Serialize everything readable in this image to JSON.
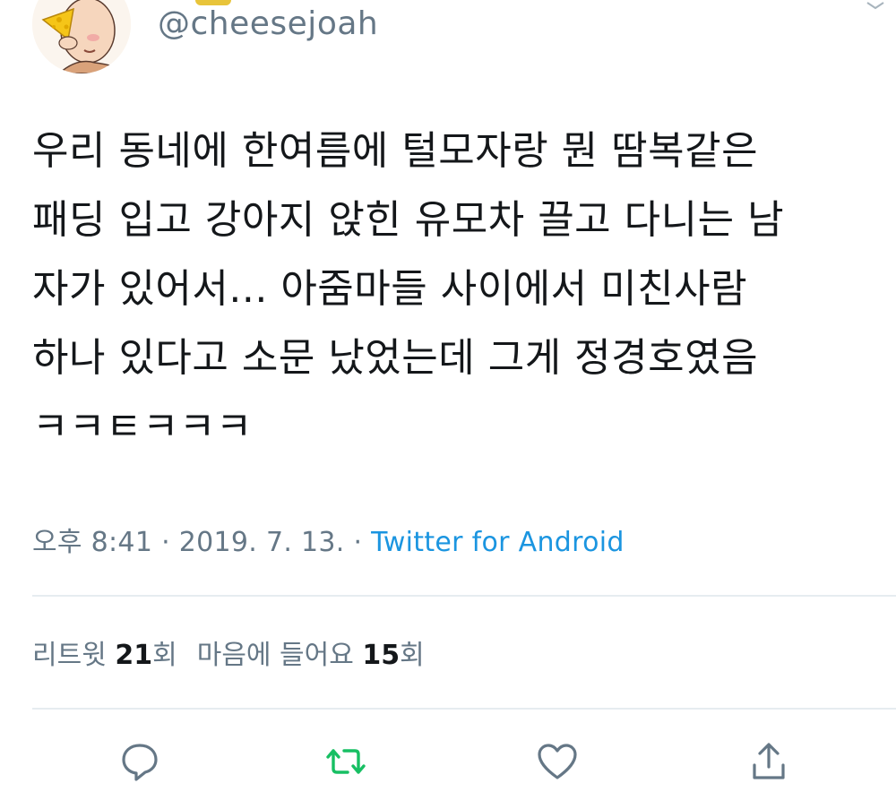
{
  "tweet": {
    "handle": "@cheesejoah",
    "text": "우리 동네에 한여름에 털모자랑 뭔 땀복같은\n패딩 입고 강아지 앉힌 유모차 끌고 다니는 남\n자가 있어서... 아줌마들 사이에서 미친사람\n하나 있다고 소문 났었는데 그게 정경호였음\nㅋㅋㅌㅋㅋㅋ",
    "time": "오후 8:41",
    "separator": "·",
    "date": "2019. 7. 13.",
    "source": "Twitter for Android"
  },
  "stats": {
    "retweet_label": "리트윗",
    "retweet_count": "21",
    "retweet_unit": "회",
    "like_label": "마음에 들어요",
    "like_count": "15",
    "like_unit": "회"
  },
  "actions": {
    "reply_icon": "reply-icon",
    "retweet_icon": "retweet-icon",
    "like_icon": "heart-icon",
    "share_icon": "share-icon"
  },
  "colors": {
    "text": "#14171a",
    "secondary": "#657786",
    "link": "#1b95e0",
    "retweet_active": "#17bf63",
    "divider": "#e6ecf0"
  }
}
